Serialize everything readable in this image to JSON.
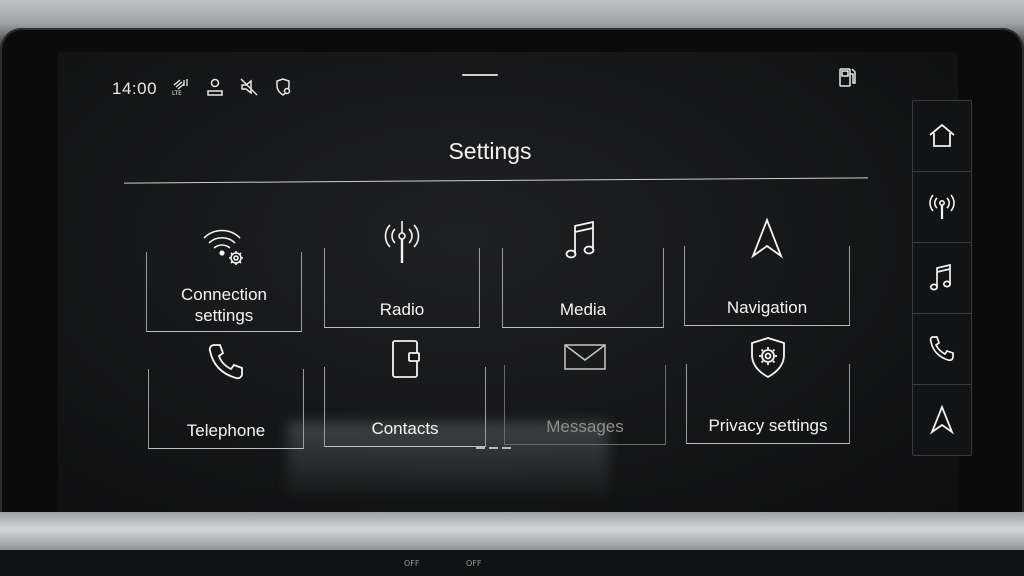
{
  "status": {
    "time": "14:00",
    "icons": [
      "signal-lte-icon",
      "user-profile-icon",
      "speaker-muted-icon",
      "location-privacy-icon"
    ],
    "fuel_icon": "fuel-pump-icon"
  },
  "header": {
    "title": "Settings"
  },
  "tiles": [
    {
      "label": "Connection\nsettings",
      "icon": "wifi-gear-icon",
      "enabled": true
    },
    {
      "label": "Radio",
      "icon": "radio-antenna-icon",
      "enabled": true
    },
    {
      "label": "Media",
      "icon": "music-note-icon",
      "enabled": true
    },
    {
      "label": "Navigation",
      "icon": "navigation-arrow-icon",
      "enabled": true
    },
    {
      "label": "Telephone",
      "icon": "phone-handset-icon",
      "enabled": true
    },
    {
      "label": "Contacts",
      "icon": "address-book-icon",
      "enabled": true
    },
    {
      "label": "Messages",
      "icon": "envelope-icon",
      "enabled": false
    },
    {
      "label": "Privacy settings",
      "icon": "shield-gear-icon",
      "enabled": true
    }
  ],
  "rail": [
    "home-icon",
    "radio-antenna-icon",
    "music-note-icon",
    "phone-handset-icon",
    "navigation-arrow-icon"
  ],
  "console": {
    "left_off": "OFF",
    "right_off": "OFF"
  },
  "colors": {
    "text": "#f4f4f4",
    "disabled": "#8e8e8e",
    "background": "#141516"
  }
}
